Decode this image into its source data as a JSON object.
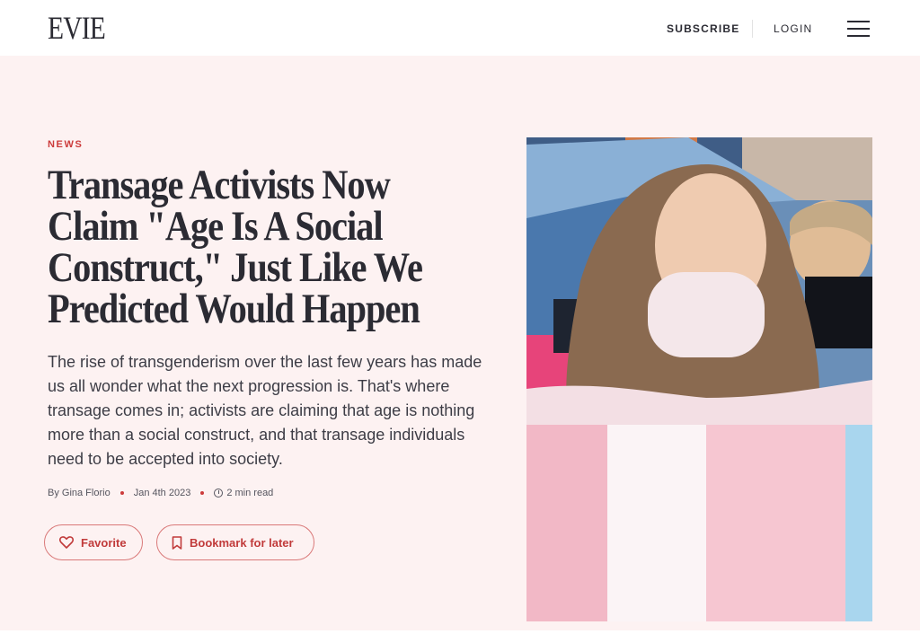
{
  "header": {
    "logo": "EVIE",
    "subscribe": "SUBSCRIBE",
    "login": "LOGIN",
    "menu_icon": "hamburger-icon"
  },
  "article": {
    "category": "NEWS",
    "title": "Transage Activists Now Claim \"Age Is A Social Construct,\" Just Like We Predicted Would Happen",
    "summary": "The rise of transgenderism over the last few years has made us all wonder what the next progression is. That's where transage comes in; activists are claiming that age is nothing more than a social construct, and that transage individuals need to be accepted into society.",
    "author": "By Gina Florio",
    "date": "Jan 4th 2023",
    "read_time": "2 min read"
  },
  "actions": {
    "favorite": "Favorite",
    "bookmark": "Bookmark for later"
  },
  "colors": {
    "accent": "#cc3b3b",
    "hero_bg": "#fdf2f2",
    "text": "#2b2b33"
  }
}
